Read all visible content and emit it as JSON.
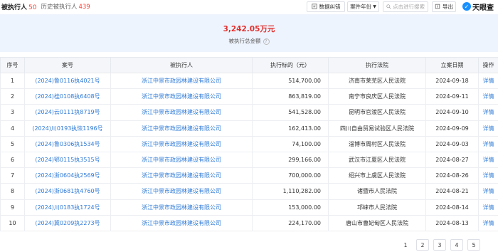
{
  "header": {
    "tab_active_label": "被执行人",
    "tab_active_count": "50",
    "tab_history_label": "历史被执行人",
    "tab_history_count": "439",
    "btn_data_error": "数据纠错",
    "btn_case_year": "案件年份",
    "search_placeholder": "点击进行搜索",
    "btn_export": "导出",
    "logo_text": "天眼查"
  },
  "summary": {
    "amount": "3,242.05万元",
    "label": "被执行总金额"
  },
  "table": {
    "columns": [
      "序号",
      "案号",
      "被执行人",
      "执行标的（元）",
      "执行法院",
      "立案日期",
      "操作"
    ],
    "rows": [
      {
        "no": "1",
        "case": "(2024)鲁0116执4021号",
        "party": "浙江中景市政园林建设有限公司",
        "amount": "514,700.00",
        "court": "济南市莱芜区人民法院",
        "date": "2024-09-18",
        "op": "详情"
      },
      {
        "no": "2",
        "case": "(2024)桂0108执6408号",
        "party": "浙江中景市政园林建设有限公司",
        "amount": "863,819.00",
        "court": "南宁市良庆区人民法院",
        "date": "2024-09-11",
        "op": "详情"
      },
      {
        "no": "3",
        "case": "(2024)云0111执8719号",
        "party": "浙江中景市政园林建设有限公司",
        "amount": "541,528.00",
        "court": "昆明市官渡区人民法院",
        "date": "2024-09-10",
        "op": "详情"
      },
      {
        "no": "4",
        "case": "(2024)川0193执恢1196号",
        "party": "浙江中景市政园林建设有限公司",
        "amount": "162,413.00",
        "court": "四川自由贸易试验区人民法院",
        "date": "2024-09-09",
        "op": "详情"
      },
      {
        "no": "5",
        "case": "(2024)鲁0306执1534号",
        "party": "浙江中景市政园林建设有限公司",
        "amount": "74,100.00",
        "court": "淄博市周村区人民法院",
        "date": "2024-09-03",
        "op": "详情"
      },
      {
        "no": "6",
        "case": "(2024)鄂0115执3515号",
        "party": "浙江中景市政园林建设有限公司",
        "amount": "299,166.00",
        "court": "武汉市江夏区人民法院",
        "date": "2024-08-27",
        "op": "详情"
      },
      {
        "no": "7",
        "case": "(2024)浙0604执2569号",
        "party": "浙江中景市政园林建设有限公司",
        "amount": "700,000.00",
        "court": "绍兴市上虞区人民法院",
        "date": "2024-08-26",
        "op": "详情"
      },
      {
        "no": "8",
        "case": "(2024)浙0681执4760号",
        "party": "浙江中景市政园林建设有限公司",
        "amount": "1,110,282.00",
        "court": "诸暨市人民法院",
        "date": "2024-08-21",
        "op": "详情"
      },
      {
        "no": "9",
        "case": "(2024)川0183执1724号",
        "party": "浙江中景市政园林建设有限公司",
        "amount": "153,000.00",
        "court": "邛崃市人民法院",
        "date": "2024-08-14",
        "op": "详情"
      },
      {
        "no": "10",
        "case": "(2024)冀0209执2273号",
        "party": "浙江中景市政园林建设有限公司",
        "amount": "224,170.00",
        "court": "唐山市曹妃甸区人民法院",
        "date": "2024-08-13",
        "op": "详情"
      }
    ]
  },
  "pagination": {
    "pages": [
      "1",
      "2",
      "3",
      "4",
      "5"
    ],
    "current": "1"
  }
}
